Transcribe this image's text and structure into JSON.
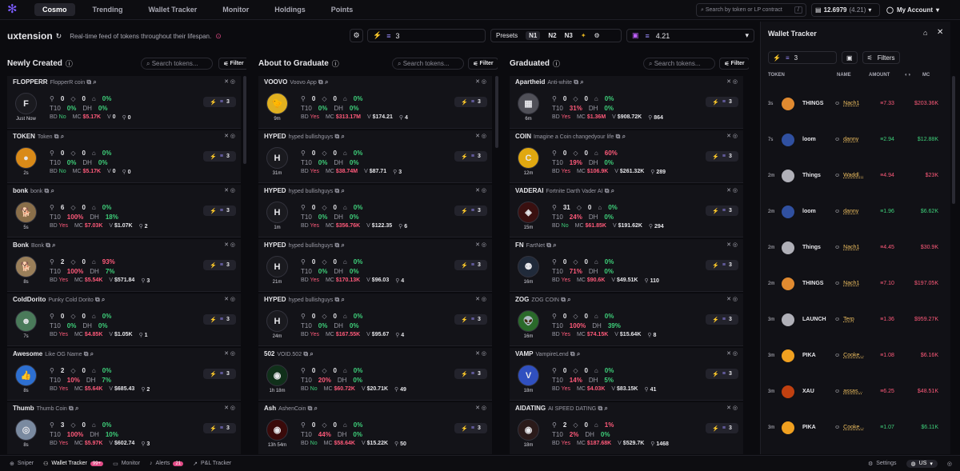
{
  "nav": {
    "logo": "✻",
    "tabs": [
      "Cosmo",
      "Trending",
      "Wallet Tracker",
      "Monitor",
      "Holdings",
      "Points"
    ],
    "search_placeholder": "Search by token or LP contract",
    "search_key": "/",
    "balance": "12.6979",
    "balance_sub": "(4.21)",
    "account": "My Account"
  },
  "header": {
    "title": "uxtension",
    "desc": "Real-time feed of tokens throughout their lifespan.",
    "bolt_count": "3",
    "presets_label": "Presets",
    "presets": [
      "N1",
      "N2",
      "N3"
    ],
    "balance": "4.21"
  },
  "columns": [
    {
      "title": "Newly Created",
      "search": "Search tokens...",
      "filter": "Filter",
      "cards": [
        {
          "sym": "FLOPPERR",
          "full": "FlopperR coin",
          "age": "Just Now",
          "h": "0",
          "c": "0",
          "p": "0%",
          "t10": "0%",
          "dh": "0%",
          "bd": "No",
          "mc": "$5.17K",
          "v": "0",
          "hold": "0",
          "av": "F",
          "avc": "#1a1a1f"
        },
        {
          "sym": "TOKEN",
          "full": "Token",
          "age": "2s",
          "h": "0",
          "c": "0",
          "p": "0%",
          "t10": "0%",
          "dh": "0%",
          "bd": "No",
          "mc": "$5.17K",
          "v": "0",
          "hold": "0",
          "av": "●",
          "avc": "#d98a18"
        },
        {
          "sym": "bonk",
          "full": "bonk",
          "age": "5s",
          "h": "6",
          "c": "0",
          "p": "0%",
          "t10": "100%",
          "dh": "18%",
          "bd": "Yes",
          "mc": "$7.03K",
          "v": "$1.07K",
          "hold": "2",
          "av": "🐕",
          "avc": "#8a6f4a"
        },
        {
          "sym": "Bonk",
          "full": "Bonk",
          "age": "8s",
          "h": "2",
          "c": "0",
          "p": "93%",
          "t10": "100%",
          "dh": "7%",
          "bd": "Yes",
          "mc": "$5.54K",
          "v": "$571.84",
          "hold": "3",
          "av": "🐕",
          "avc": "#9a7f5a"
        },
        {
          "sym": "ColdDorito",
          "full": "Punky Cold Dorito",
          "age": "7s",
          "h": "0",
          "c": "0",
          "p": "0%",
          "t10": "0%",
          "dh": "0%",
          "bd": "Yes",
          "mc": "$4.85K",
          "v": "$1.05K",
          "hold": "1",
          "av": "☻",
          "avc": "#4a7a5a"
        },
        {
          "sym": "Awesome",
          "full": "Like OG Name",
          "age": "8s",
          "h": "2",
          "c": "0",
          "p": "0%",
          "t10": "10%",
          "dh": "7%",
          "bd": "Yes",
          "mc": "$5.64K",
          "v": "$685.43",
          "hold": "2",
          "av": "👍",
          "avc": "#2d6fd0"
        },
        {
          "sym": "Thumb",
          "full": "Thumb Coin",
          "age": "8s",
          "h": "3",
          "c": "0",
          "p": "0%",
          "t10": "100%",
          "dh": "10%",
          "bd": "Yes",
          "mc": "$5.97K",
          "v": "$602.74",
          "hold": "3",
          "av": "◎",
          "avc": "#7a8aa0"
        }
      ]
    },
    {
      "title": "About to Graduate",
      "search": "Search tokens...",
      "filter": "Filter",
      "cards": [
        {
          "sym": "VOOVO",
          "full": "Voovo App",
          "age": "9m",
          "h": "0",
          "c": "0",
          "p": "0%",
          "t10": "0%",
          "dh": "0%",
          "bd": "Yes",
          "mc": "$313.17M",
          "v": "$174.21",
          "hold": "4",
          "av": "🐤",
          "avc": "#e0b020"
        },
        {
          "sym": "HYPED",
          "full": "hyped bullishguys",
          "age": "31m",
          "h": "0",
          "c": "0",
          "p": "0%",
          "t10": "0%",
          "dh": "0%",
          "bd": "Yes",
          "mc": "$38.74M",
          "v": "$87.71",
          "hold": "3",
          "av": "H",
          "avc": "#1a1a1f"
        },
        {
          "sym": "HYPED",
          "full": "hyped bullishguys",
          "age": "1m",
          "h": "0",
          "c": "0",
          "p": "0%",
          "t10": "0%",
          "dh": "0%",
          "bd": "Yes",
          "mc": "$356.76K",
          "v": "$122.35",
          "hold": "6",
          "av": "H",
          "avc": "#1a1a1f"
        },
        {
          "sym": "HYPED",
          "full": "hyped bullishguys",
          "age": "21m",
          "h": "0",
          "c": "0",
          "p": "0%",
          "t10": "0%",
          "dh": "0%",
          "bd": "Yes",
          "mc": "$170.13K",
          "v": "$96.03",
          "hold": "4",
          "av": "H",
          "avc": "#1a1a1f"
        },
        {
          "sym": "HYPED",
          "full": "hyped bullishguys",
          "age": "24m",
          "h": "0",
          "c": "0",
          "p": "0%",
          "t10": "0%",
          "dh": "0%",
          "bd": "Yes",
          "mc": "$167.55K",
          "v": "$95.67",
          "hold": "4",
          "av": "H",
          "avc": "#1a1a1f"
        },
        {
          "sym": "502",
          "full": "VOID.502",
          "age": "1h 18m",
          "h": "0",
          "c": "0",
          "p": "0%",
          "t10": "20%",
          "dh": "0%",
          "bd": "No",
          "mc": "$60.72K",
          "v": "$20.71K",
          "hold": "49",
          "av": "◉",
          "avc": "#10301a"
        },
        {
          "sym": "Ash",
          "full": "AshenCoin",
          "age": "13h 54m",
          "h": "0",
          "c": "0",
          "p": "0%",
          "t10": "44%",
          "dh": "0%",
          "bd": "No",
          "mc": "$58.64K",
          "v": "$15.22K",
          "hold": "50",
          "av": "◉",
          "avc": "#3a0a0a"
        }
      ]
    },
    {
      "title": "Graduated",
      "search": "Search tokens...",
      "filter": "Filter",
      "cards": [
        {
          "sym": "Apartheid",
          "full": "Anti-white",
          "age": "6m",
          "h": "0",
          "c": "0",
          "p": "0%",
          "t10": "31%",
          "dh": "0%",
          "bd": "Yes",
          "mc": "$1.36M",
          "v": "$908.72K",
          "hold": "864",
          "av": "▦",
          "avc": "#505058"
        },
        {
          "sym": "COIN",
          "full": "Imagine a Coin changedyour life",
          "age": "12m",
          "h": "0",
          "c": "0",
          "p": "60%",
          "t10": "19%",
          "dh": "0%",
          "bd": "Yes",
          "mc": "$106.9K",
          "v": "$261.32K",
          "hold": "289",
          "av": "C",
          "avc": "#e0a810"
        },
        {
          "sym": "VADERAI",
          "full": "Fortnite Darth Vader AI",
          "age": "15m",
          "h": "31",
          "c": "0",
          "p": "0%",
          "t10": "24%",
          "dh": "0%",
          "bd": "No",
          "mc": "$61.85K",
          "v": "$191.62K",
          "hold": "294",
          "av": "◈",
          "avc": "#3a1010"
        },
        {
          "sym": "FN",
          "full": "FartNet",
          "age": "16m",
          "h": "0",
          "c": "0",
          "p": "0%",
          "t10": "71%",
          "dh": "0%",
          "bd": "Yes",
          "mc": "$90.6K",
          "v": "$49.51K",
          "hold": "110",
          "av": "⚉",
          "avc": "#202a3a"
        },
        {
          "sym": "ZOG",
          "full": "ZOG COIN",
          "age": "16m",
          "h": "0",
          "c": "0",
          "p": "0%",
          "t10": "100%",
          "dh": "39%",
          "bd": "Yes",
          "mc": "$74.15K",
          "v": "$15.64K",
          "hold": "8",
          "av": "👽",
          "avc": "#2a6a2a"
        },
        {
          "sym": "VAMP",
          "full": "VampireLend",
          "age": "18m",
          "h": "0",
          "c": "0",
          "p": "0%",
          "t10": "14%",
          "dh": "5%",
          "bd": "Yes",
          "mc": "$4.03K",
          "v": "$83.15K",
          "hold": "41",
          "av": "V",
          "avc": "#3050c0"
        },
        {
          "sym": "AIDATING",
          "full": "AI SPEED DATING",
          "age": "18m",
          "h": "2",
          "c": "0",
          "p": "1%",
          "t10": "2%",
          "dh": "0%",
          "bd": "Yes",
          "mc": "$187.68K",
          "v": "$529.7K",
          "hold": "1468",
          "av": "◉",
          "avc": "#2a1a1a"
        }
      ]
    }
  ],
  "tracker": {
    "title": "Wallet Tracker",
    "bolt_count": "3",
    "filters": "Filters",
    "cols": [
      "TOKEN",
      "NAME",
      "AMOUNT",
      "MC"
    ],
    "rows": [
      {
        "t": "3s",
        "tok": "THINGS",
        "who": "Nach1",
        "amt": "7.33",
        "mc": "$203.36K",
        "c": "#e08a30",
        "up": false
      },
      {
        "t": "7s",
        "tok": "loom",
        "who": "danny",
        "amt": "2.94",
        "mc": "$12.88K",
        "c": "#3050a0",
        "up": true
      },
      {
        "t": "2m",
        "tok": "Things",
        "who": "Waddl...",
        "amt": "4.94",
        "mc": "$23K",
        "c": "#b0b0b8",
        "up": false
      },
      {
        "t": "2m",
        "tok": "loom",
        "who": "danny",
        "amt": "1.96",
        "mc": "$6.62K",
        "c": "#3050a0",
        "up": true
      },
      {
        "t": "2m",
        "tok": "Things",
        "who": "Nach1",
        "amt": "4.45",
        "mc": "$30.9K",
        "c": "#b0b0b8",
        "up": false
      },
      {
        "t": "2m",
        "tok": "THINGS",
        "who": "Nach1",
        "amt": "7.10",
        "mc": "$197.05K",
        "c": "#e08a30",
        "up": false
      },
      {
        "t": "3m",
        "tok": "LAUNCH",
        "who": "Terp",
        "amt": "1.36",
        "mc": "$959.27K",
        "c": "#b0b0b8",
        "up": false
      },
      {
        "t": "3m",
        "tok": "PIKA",
        "who": "Cooke...",
        "amt": "1.08",
        "mc": "$6.16K",
        "c": "#f0a020",
        "up": false
      },
      {
        "t": "3m",
        "tok": "XAU",
        "who": "assas...",
        "amt": "6.25",
        "mc": "$48.51K",
        "c": "#c04010",
        "up": false
      },
      {
        "t": "3m",
        "tok": "PIKA",
        "who": "Cooke...",
        "amt": "1.07",
        "mc": "$6.11K",
        "c": "#f0a020",
        "up": true
      }
    ]
  },
  "bottom": {
    "items": [
      "Sniper",
      "Wallet Tracker",
      "Monitor",
      "Alerts",
      "P&L Tracker"
    ],
    "wallet_badge": "99+",
    "alerts_badge": "21",
    "settings": "Settings",
    "region": "US"
  }
}
